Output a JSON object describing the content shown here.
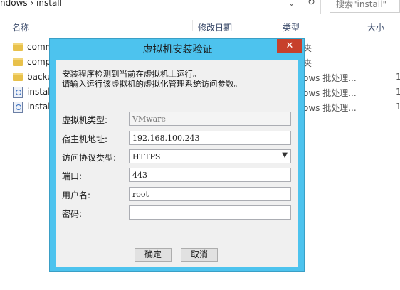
{
  "explorer": {
    "address_text": "ndows  ›  install",
    "address_chevron": "⌄",
    "refresh_icon": "↻",
    "search_placeholder": "搜索\"install\"",
    "columns": {
      "name": "名称",
      "modified": "修改日期",
      "type": "类型",
      "size": "大小"
    },
    "files": [
      {
        "icon": "folder-icon",
        "name": "comm",
        "type": "夹",
        "size": ""
      },
      {
        "icon": "folder-icon",
        "name": "comp",
        "type": "夹",
        "size": ""
      },
      {
        "icon": "folder-icon",
        "name": "backu",
        "type": "ows 批处理...",
        "size": "1"
      },
      {
        "icon": "batch-file-icon",
        "name": "instal",
        "type": "ows 批处理...",
        "size": "1"
      },
      {
        "icon": "batch-file-icon",
        "name": "instal",
        "type": "ows 批处理...",
        "size": "1"
      }
    ]
  },
  "dialog": {
    "title": "虚拟机安装验证",
    "close_label": "✕",
    "message_line1": "安装程序检测到当前在虚拟机上运行。",
    "message_line2": "请输入运行该虚拟机的虚拟化管理系统访问参数。",
    "fields": {
      "vm_type": {
        "label": "虚拟机类型:",
        "value": "VMware"
      },
      "host_address": {
        "label": "宿主机地址:",
        "value": "192.168.100.243"
      },
      "protocol": {
        "label": "访问协议类型:",
        "value": "HTTPS"
      },
      "port": {
        "label": "端口:",
        "value": "443"
      },
      "username": {
        "label": "用户名:",
        "value": "root"
      },
      "password": {
        "label": "密码:",
        "value": ""
      }
    },
    "ok_label": "确定",
    "cancel_label": "取消"
  }
}
